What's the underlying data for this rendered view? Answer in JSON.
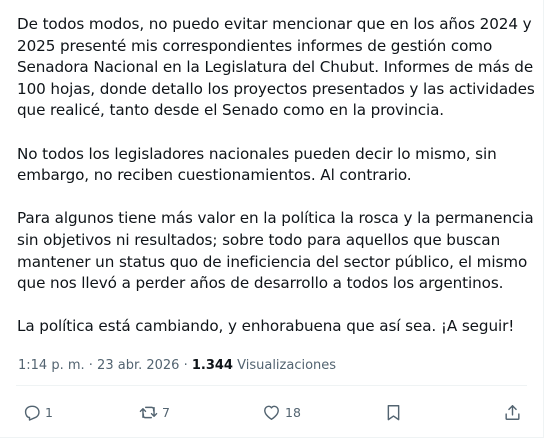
{
  "tweet": {
    "paragraphs": [
      "De todos modos, no puedo evitar mencionar que en los años 2024 y 2025 presenté mis correspondientes informes de gestión como Senadora Nacional en la Legislatura del Chubut. Informes de más de 100 hojas, donde detallo los proyectos presentados y las actividades que realicé, tanto desde el Senado como en la provincia.",
      "No todos los legisladores nacionales pueden decir lo mismo, sin embargo, no reciben cuestionamientos. Al contrario.",
      "Para algunos tiene más valor en la política la rosca y la permanencia sin objetivos ni resultados; sobre todo para aquellos que buscan mantener un status quo de ineficiencia del sector público, el mismo que nos llevó a perder años de desarrollo a todos los argentinos.",
      "La política está cambiando, y enhorabuena que así sea. ¡A seguir!"
    ],
    "time": "1:14 p. m.",
    "separator": " · ",
    "date": "23 abr. 2026",
    "views_count": "1.344",
    "views_label": "Visualizaciones"
  },
  "actions": {
    "reply": {
      "icon": "reply-icon",
      "count": "1"
    },
    "retweet": {
      "icon": "retweet-icon",
      "count": "7"
    },
    "like": {
      "icon": "heart-icon",
      "count": "18"
    },
    "bookmark": {
      "icon": "bookmark-icon",
      "count": ""
    },
    "share": {
      "icon": "share-icon",
      "count": ""
    }
  },
  "colors": {
    "text": "#0f1419",
    "secondary": "#536471",
    "border": "#eff3f4"
  }
}
